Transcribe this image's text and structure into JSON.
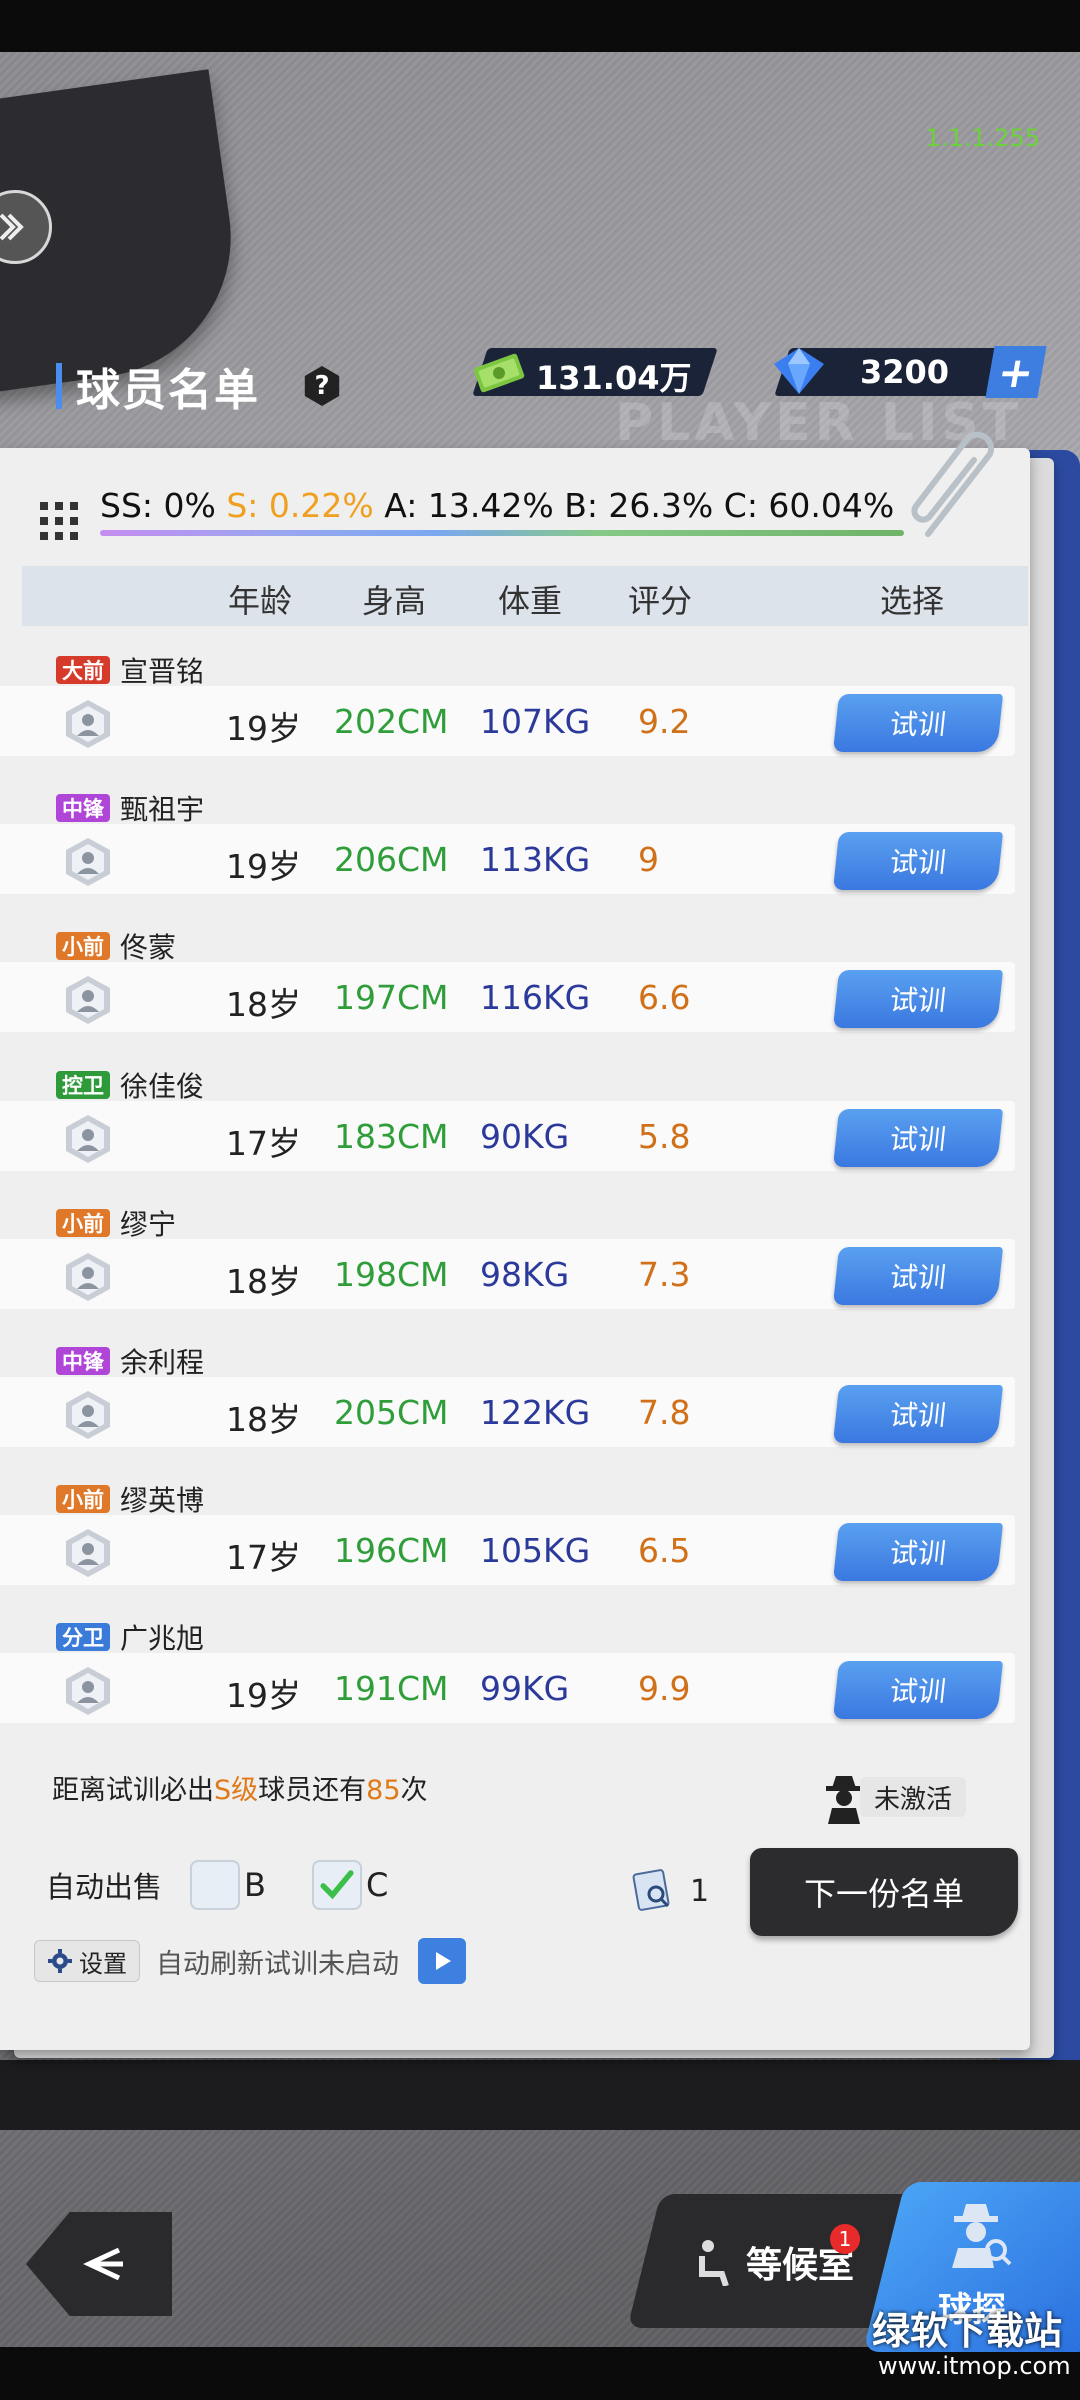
{
  "version": "1.1.1.255",
  "header": {
    "title": "球员名单",
    "help": "?",
    "watermark": "PLAYER LIST",
    "money": "131.04万",
    "gems": "3200",
    "gem_add": "+"
  },
  "rates": {
    "ss": "SS: 0%",
    "s": "S: 0.22%",
    "a": "A: 13.42%",
    "b": "B: 26.3%",
    "c": "C: 60.04%"
  },
  "table_headers": {
    "age": "年龄",
    "height": "身高",
    "weight": "体重",
    "score": "评分",
    "select": "选择"
  },
  "players": [
    {
      "position": "大前",
      "pos_color": "#d63a2a",
      "name": "宣晋铭",
      "age": "19岁",
      "height": "202CM",
      "weight": "107KG",
      "score": "9.2",
      "action": "试训"
    },
    {
      "position": "中锋",
      "pos_color": "#b046d8",
      "name": "甄祖宇",
      "age": "19岁",
      "height": "206CM",
      "weight": "113KG",
      "score": "9",
      "action": "试训"
    },
    {
      "position": "小前",
      "pos_color": "#e0782a",
      "name": "佟蒙",
      "age": "18岁",
      "height": "197CM",
      "weight": "116KG",
      "score": "6.6",
      "action": "试训"
    },
    {
      "position": "控卫",
      "pos_color": "#2f9a3a",
      "name": "徐佳俊",
      "age": "17岁",
      "height": "183CM",
      "weight": "90KG",
      "score": "5.8",
      "action": "试训"
    },
    {
      "position": "小前",
      "pos_color": "#e0782a",
      "name": "缪宁",
      "age": "18岁",
      "height": "198CM",
      "weight": "98KG",
      "score": "7.3",
      "action": "试训"
    },
    {
      "position": "中锋",
      "pos_color": "#b046d8",
      "name": "余利程",
      "age": "18岁",
      "height": "205CM",
      "weight": "122KG",
      "score": "7.8",
      "action": "试训"
    },
    {
      "position": "小前",
      "pos_color": "#e0782a",
      "name": "缪英博",
      "age": "17岁",
      "height": "196CM",
      "weight": "105KG",
      "score": "6.5",
      "action": "试训"
    },
    {
      "position": "分卫",
      "pos_color": "#3a7ad8",
      "name": "广兆旭",
      "age": "19岁",
      "height": "191CM",
      "weight": "99KG",
      "score": "9.9",
      "action": "试训"
    }
  ],
  "footer": {
    "guarantee_pre": "距离试训必出",
    "guarantee_grade": "S级",
    "guarantee_mid": "球员还有",
    "guarantee_count": "85",
    "guarantee_post": "次",
    "inactive": "未激活",
    "autosell": "自动出售",
    "opt_b": "B",
    "opt_c": "C",
    "ticket_count": "1",
    "next_list": "下一份名单",
    "settings": "设置",
    "auto_refresh": "自动刷新试训未启动"
  },
  "nav": {
    "back": "<",
    "waiting_room": "等候室",
    "waiting_badge": "1",
    "scout": "球探"
  },
  "watermark_site": "绿软下载站",
  "watermark_url": "www.itmop.com"
}
